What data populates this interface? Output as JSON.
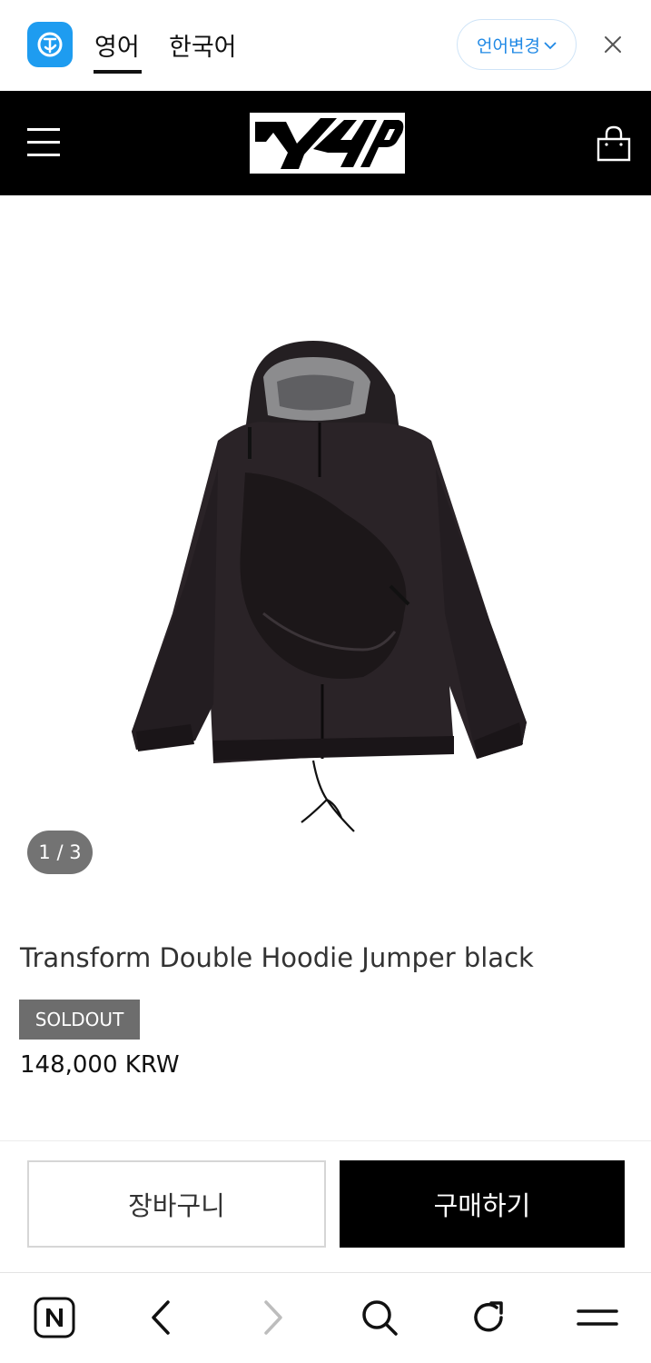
{
  "translation_bar": {
    "active_language": "영어",
    "other_language": "한국어",
    "change_language_label": "언어변경"
  },
  "product": {
    "image_counter": "1 / 3",
    "title": "Transform Double Hoodie Jumper black",
    "status_badge": "SOLDOUT",
    "price": "148,000 KRW"
  },
  "actions": {
    "cart_label": "장바구니",
    "buy_label": "구매하기"
  },
  "browser_toolbar": {
    "icons": [
      "naver-home-icon",
      "back-icon",
      "forward-icon",
      "search-icon",
      "refresh-icon",
      "menu-icon"
    ]
  },
  "colors": {
    "translate_accent": "#1e88e5",
    "header_bg": "#000000",
    "soldout_bg": "#6d6d6d",
    "buy_bg": "#000000"
  }
}
